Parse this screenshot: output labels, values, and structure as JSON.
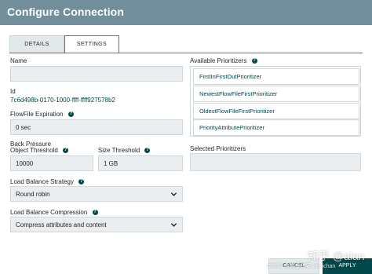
{
  "dialog": {
    "title": "Configure Connection"
  },
  "tabs": [
    {
      "label": "DETAILS"
    },
    {
      "label": "SETTINGS"
    }
  ],
  "settings": {
    "name_label": "Name",
    "name_value": "",
    "id_label": "Id",
    "id_value": "7c6d498b-0170-1000-ffff-ffff927578b2",
    "flowfile_expiration_label": "FlowFile Expiration",
    "flowfile_expiration_value": "0 sec",
    "back_pressure_label_line1": "Back Pressure",
    "object_threshold_label": "Object Threshold",
    "object_threshold_value": "10000",
    "size_threshold_label": "Size Threshold",
    "size_threshold_value": "1 GB",
    "load_balance_strategy_label": "Load Balance Strategy",
    "load_balance_strategy_value": "Round robin",
    "load_balance_compression_label": "Load Balance Compression",
    "load_balance_compression_value": "Compress attributes and content",
    "available_prioritizers_label": "Available Prioritizers",
    "available_prioritizers": [
      "FirstInFirstOutPrioritizer",
      "NewestFlowFileFirstPrioritizer",
      "OldestFlowFileFirstPrioritizer",
      "PriorityAttributePrioritizer"
    ],
    "selected_prioritizers_label": "Selected Prioritizers"
  },
  "buttons": {
    "cancel": "CANCEL",
    "apply": "APPLY"
  },
  "watermark": {
    "line1": "知乎 @alan",
    "line2": "CSDN @数据砖家 alanchan"
  },
  "icons": {
    "help": "help-icon",
    "chevron": "chevron-down-icon"
  },
  "colors": {
    "header": "#728e9b",
    "accent": "#004849",
    "field_bg": "#eaeef0"
  }
}
